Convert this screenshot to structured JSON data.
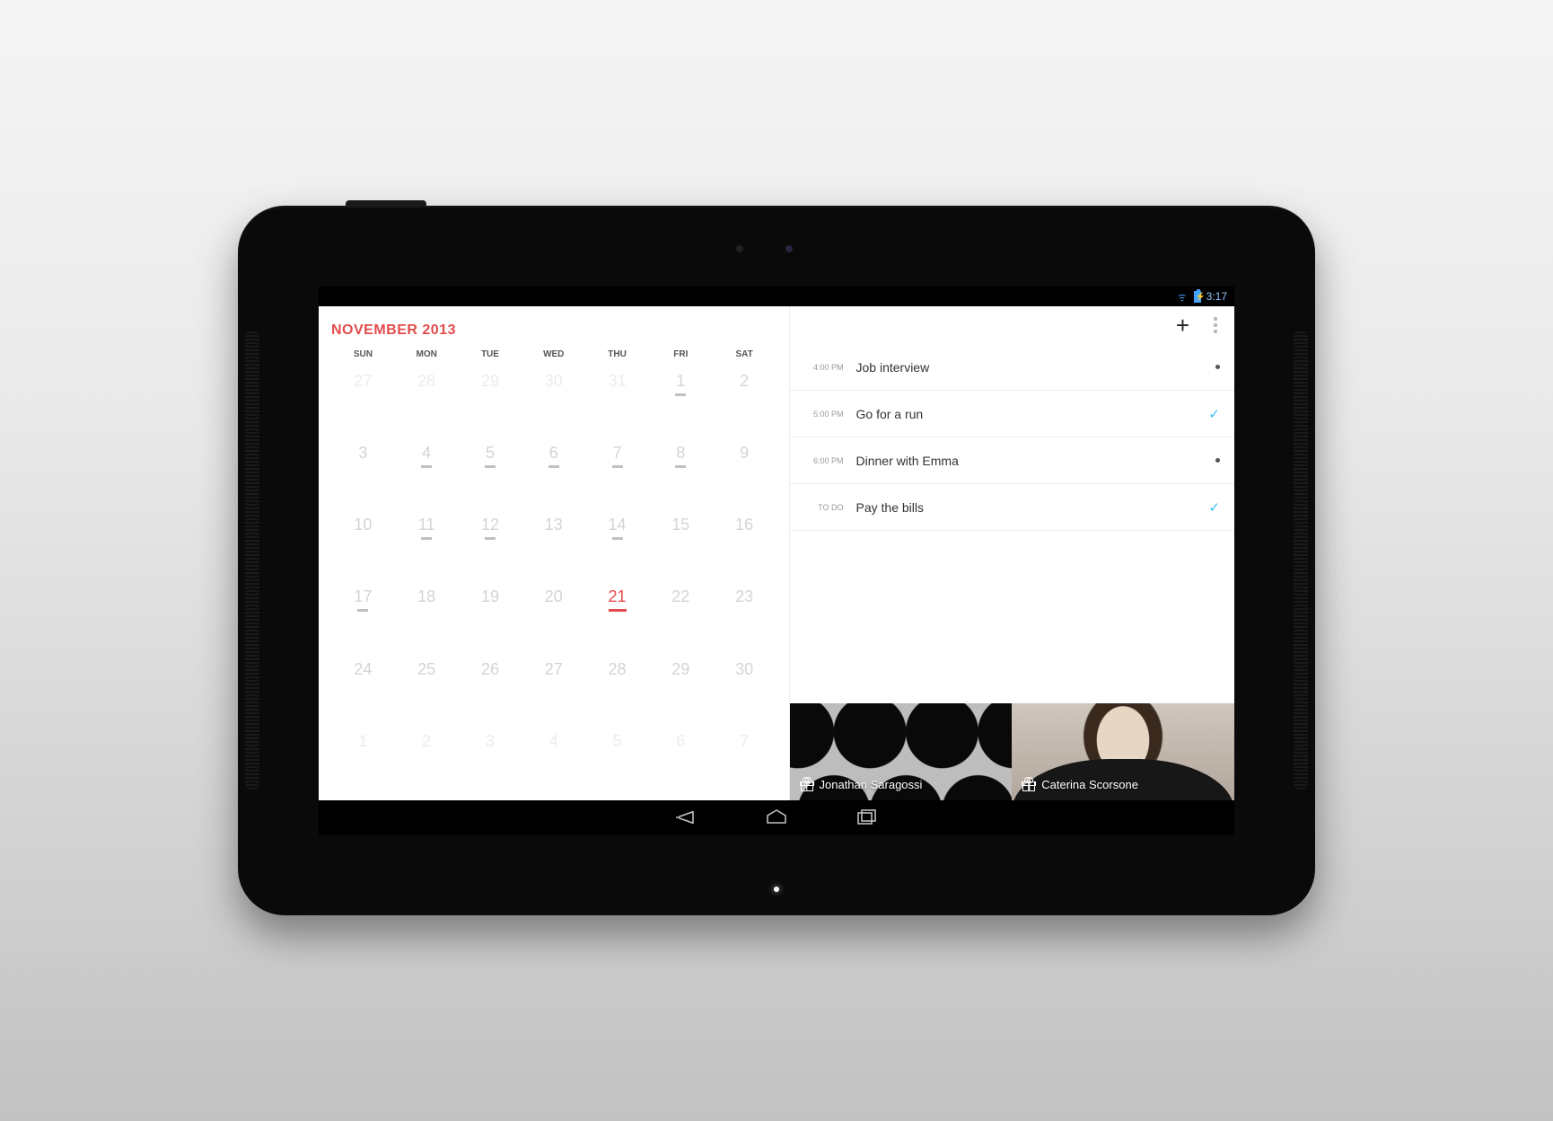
{
  "status_bar": {
    "time": "3:17"
  },
  "calendar": {
    "month_title": "NOVEMBER 2013",
    "weekdays": [
      "SUN",
      "MON",
      "TUE",
      "WED",
      "THU",
      "FRI",
      "SAT"
    ],
    "cells": [
      {
        "n": "27",
        "other": true
      },
      {
        "n": "28",
        "other": true
      },
      {
        "n": "29",
        "other": true
      },
      {
        "n": "30",
        "other": true
      },
      {
        "n": "31",
        "other": true
      },
      {
        "n": "1",
        "mark": true
      },
      {
        "n": "2"
      },
      {
        "n": "3"
      },
      {
        "n": "4",
        "mark": true
      },
      {
        "n": "5",
        "mark": true
      },
      {
        "n": "6",
        "mark": true
      },
      {
        "n": "7",
        "mark": true
      },
      {
        "n": "8",
        "mark": true
      },
      {
        "n": "9"
      },
      {
        "n": "10"
      },
      {
        "n": "11",
        "mark": true
      },
      {
        "n": "12",
        "mark": true
      },
      {
        "n": "13"
      },
      {
        "n": "14",
        "mark": true
      },
      {
        "n": "15"
      },
      {
        "n": "16"
      },
      {
        "n": "17",
        "mark": true
      },
      {
        "n": "18"
      },
      {
        "n": "19"
      },
      {
        "n": "20"
      },
      {
        "n": "21",
        "mark": true,
        "selected": true
      },
      {
        "n": "22"
      },
      {
        "n": "23"
      },
      {
        "n": "24"
      },
      {
        "n": "25"
      },
      {
        "n": "26"
      },
      {
        "n": "27"
      },
      {
        "n": "28"
      },
      {
        "n": "29"
      },
      {
        "n": "30"
      },
      {
        "n": "1",
        "other": true
      },
      {
        "n": "2",
        "other": true
      },
      {
        "n": "3",
        "other": true
      },
      {
        "n": "4",
        "other": true
      },
      {
        "n": "5",
        "other": true
      },
      {
        "n": "6",
        "other": true
      },
      {
        "n": "7",
        "other": true
      }
    ]
  },
  "events": [
    {
      "time": "4:00 PM",
      "title": "Job interview",
      "status": "dot"
    },
    {
      "time": "5:00 PM",
      "title": "Go for a run",
      "status": "check"
    },
    {
      "time": "6:00 PM",
      "title": "Dinner with Emma",
      "status": "dot"
    },
    {
      "time": "TO DO",
      "title": "Pay the bills",
      "status": "check"
    }
  ],
  "contacts": [
    {
      "name": "Jonathan Saragossi"
    },
    {
      "name": "Caterina Scorsone"
    }
  ]
}
